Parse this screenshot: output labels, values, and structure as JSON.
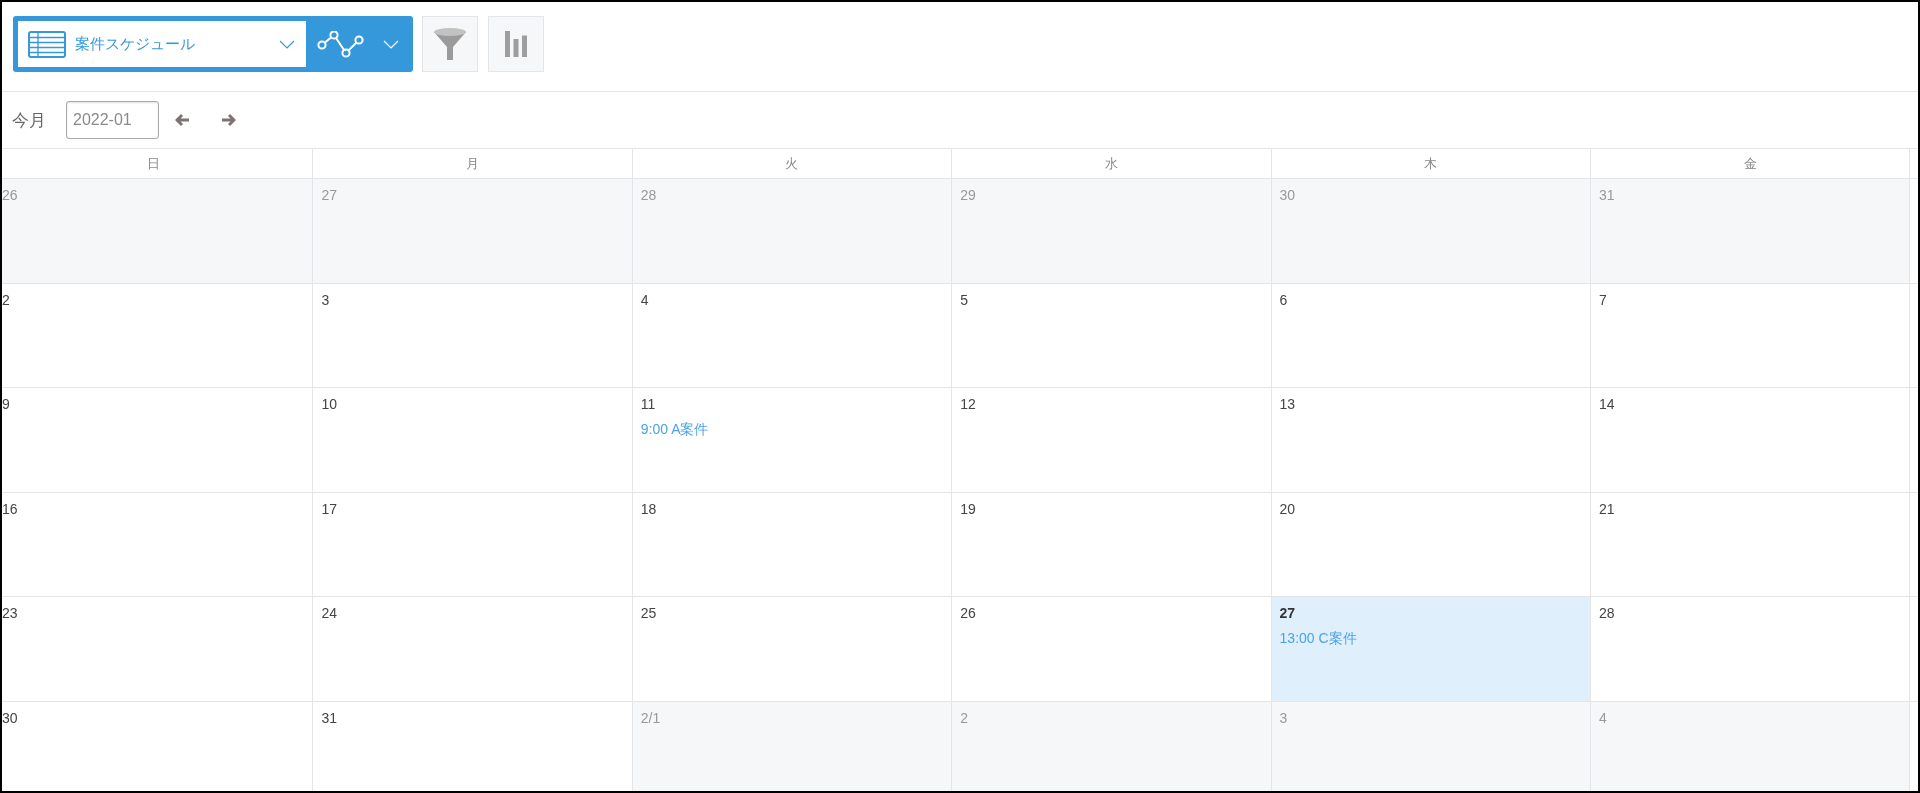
{
  "view_switcher": {
    "view_label": "案件スケジュール"
  },
  "navigation": {
    "this_month_label": "今月",
    "month_value": "2022-01"
  },
  "calendar": {
    "weekdays": [
      "日",
      "月",
      "火",
      "水",
      "木",
      "金"
    ],
    "weeks": [
      {
        "days": [
          {
            "day": "26",
            "other_month": true,
            "today": false
          },
          {
            "day": "27",
            "other_month": true,
            "today": false
          },
          {
            "day": "28",
            "other_month": true,
            "today": false
          },
          {
            "day": "29",
            "other_month": true,
            "today": false
          },
          {
            "day": "30",
            "other_month": true,
            "today": false
          },
          {
            "day": "31",
            "other_month": true,
            "today": false
          }
        ]
      },
      {
        "days": [
          {
            "day": "2",
            "other_month": false,
            "today": false
          },
          {
            "day": "3",
            "other_month": false,
            "today": false
          },
          {
            "day": "4",
            "other_month": false,
            "today": false
          },
          {
            "day": "5",
            "other_month": false,
            "today": false
          },
          {
            "day": "6",
            "other_month": false,
            "today": false
          },
          {
            "day": "7",
            "other_month": false,
            "today": false
          }
        ]
      },
      {
        "days": [
          {
            "day": "9",
            "other_month": false,
            "today": false
          },
          {
            "day": "10",
            "other_month": false,
            "today": false
          },
          {
            "day": "11",
            "other_month": false,
            "today": false,
            "events": [
              "9:00 A案件"
            ]
          },
          {
            "day": "12",
            "other_month": false,
            "today": false
          },
          {
            "day": "13",
            "other_month": false,
            "today": false
          },
          {
            "day": "14",
            "other_month": false,
            "today": false
          }
        ]
      },
      {
        "days": [
          {
            "day": "16",
            "other_month": false,
            "today": false
          },
          {
            "day": "17",
            "other_month": false,
            "today": false
          },
          {
            "day": "18",
            "other_month": false,
            "today": false
          },
          {
            "day": "19",
            "other_month": false,
            "today": false
          },
          {
            "day": "20",
            "other_month": false,
            "today": false
          },
          {
            "day": "21",
            "other_month": false,
            "today": false
          }
        ]
      },
      {
        "days": [
          {
            "day": "23",
            "other_month": false,
            "today": false
          },
          {
            "day": "24",
            "other_month": false,
            "today": false
          },
          {
            "day": "25",
            "other_month": false,
            "today": false
          },
          {
            "day": "26",
            "other_month": false,
            "today": false
          },
          {
            "day": "27",
            "other_month": false,
            "today": true,
            "events": [
              "13:00 C案件"
            ]
          },
          {
            "day": "28",
            "other_month": false,
            "today": false
          }
        ]
      },
      {
        "days": [
          {
            "day": "30",
            "other_month": false,
            "today": false
          },
          {
            "day": "31",
            "other_month": false,
            "today": false
          },
          {
            "day": "2/1",
            "other_month": true,
            "today": false
          },
          {
            "day": "2",
            "other_month": true,
            "today": false
          },
          {
            "day": "3",
            "other_month": true,
            "today": false
          },
          {
            "day": "4",
            "other_month": true,
            "today": false
          }
        ]
      }
    ]
  }
}
